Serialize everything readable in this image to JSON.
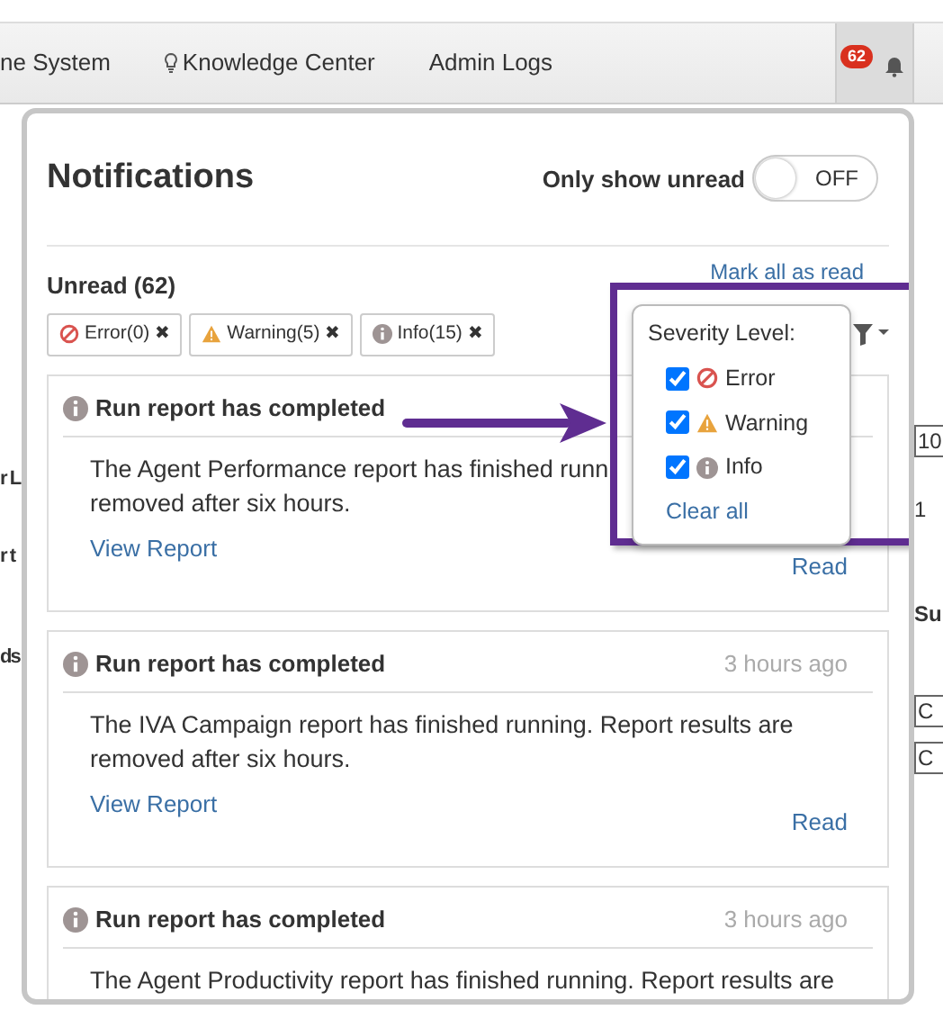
{
  "navbar": {
    "items": [
      {
        "label": "ne System"
      },
      {
        "label": "Knowledge Center"
      },
      {
        "label": "Admin Logs"
      }
    ],
    "bell_badge": "62"
  },
  "background": {
    "left": [
      "r L",
      "r t",
      "ds"
    ],
    "right": [
      {
        "text": "10",
        "kind": "field"
      },
      {
        "text": "1",
        "kind": "plain"
      },
      {
        "text": "Su",
        "kind": "bold"
      },
      {
        "text": "C",
        "kind": "field"
      },
      {
        "text": "C",
        "kind": "field"
      }
    ]
  },
  "panel": {
    "title": "Notifications",
    "unread_toggle": {
      "label": "Only show unread",
      "on": false,
      "state_text": "OFF"
    },
    "unread_heading": "Unread (62)",
    "mark_all": "Mark all as read",
    "chips": [
      {
        "kind": "error",
        "label": "Error(0)",
        "remove": "✖"
      },
      {
        "kind": "warning",
        "label": "Warning(5)",
        "remove": "✖"
      },
      {
        "kind": "info",
        "label": "Info(15)",
        "remove": "✖"
      }
    ],
    "filter_popover": {
      "title": "Severity Level:",
      "options": [
        {
          "kind": "error",
          "label": "Error",
          "checked": true
        },
        {
          "kind": "warning",
          "label": "Warning",
          "checked": true
        },
        {
          "kind": "info",
          "label": "Info",
          "checked": true
        }
      ],
      "clear": "Clear all"
    },
    "cards": [
      {
        "kind": "info",
        "title": "Run report has completed",
        "body_lines": [
          "The Agent Performance report has finished runn",
          "removed after six hours."
        ],
        "link": "View Report",
        "action": "Read"
      },
      {
        "kind": "info",
        "title": "Run report has completed",
        "time": "3 hours ago",
        "body_lines": [
          "The IVA Campaign report has finished running. Report results are",
          "removed after six hours."
        ],
        "link": "View Report",
        "action": "Read"
      },
      {
        "kind": "info",
        "title": "Run report has completed",
        "time": "3 hours ago",
        "body_lines": [
          "The Agent Productivity report has finished running. Report results are"
        ]
      }
    ]
  }
}
